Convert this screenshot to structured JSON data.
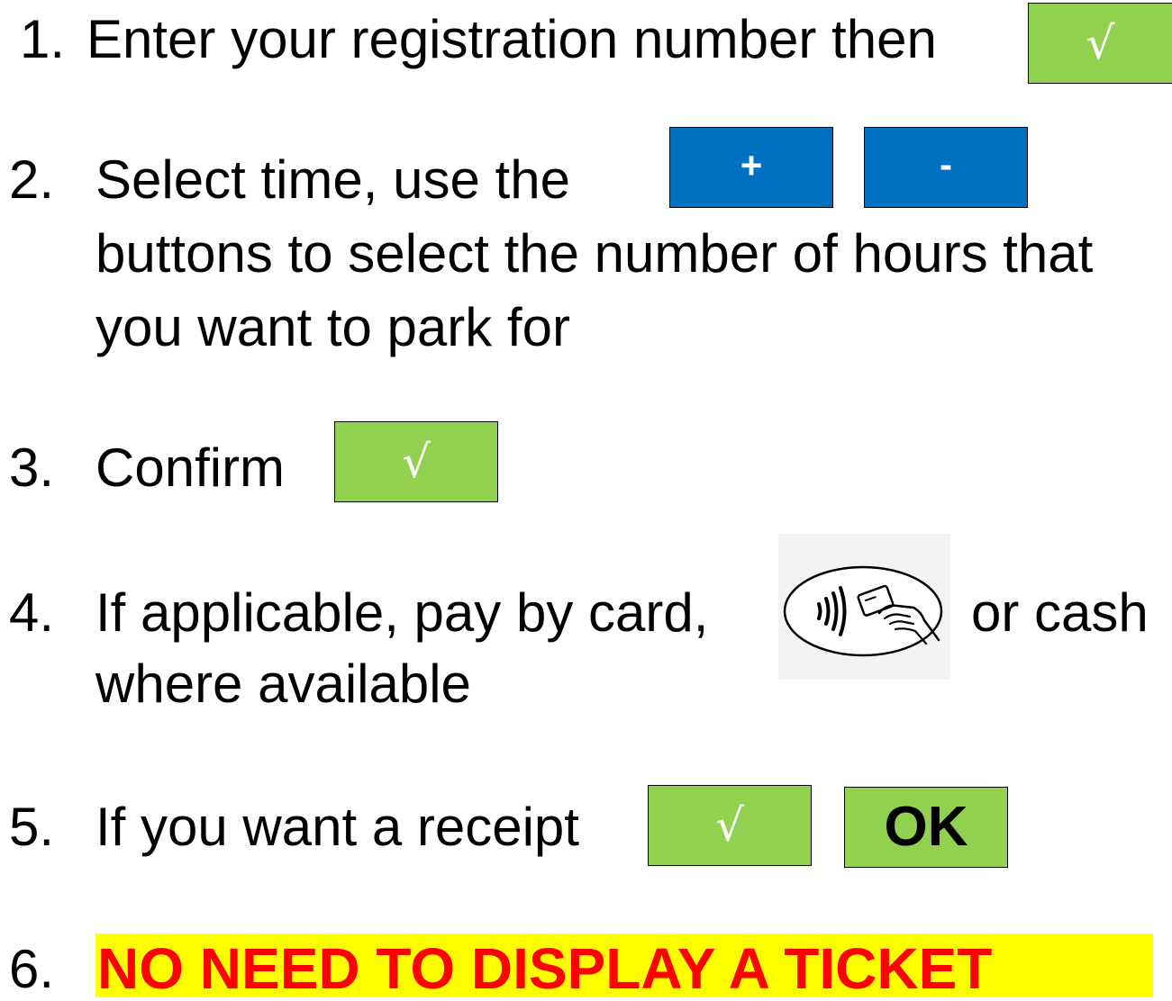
{
  "step1": {
    "number": "1.",
    "text": "Enter your registration number then",
    "button_label": "√"
  },
  "step2": {
    "number": "2.",
    "line1": "Select time, use the",
    "line2": "buttons to select the number of hours that",
    "line3": "you want to park for",
    "plus_label": "+",
    "minus_label": "-"
  },
  "step3": {
    "number": "3.",
    "text": "Confirm",
    "button_label": "√"
  },
  "step4": {
    "number": "4.",
    "line1_before": "If applicable, pay by card,",
    "line1_after": "or cash",
    "line2": "where available",
    "icon": "contactless-card-icon"
  },
  "step5": {
    "number": "5.",
    "text": "If you want a receipt",
    "tick_label": "√",
    "ok_label": "OK"
  },
  "step6": {
    "number": "6.",
    "text": "NO NEED TO DISPLAY A TICKET"
  },
  "colors": {
    "green_button": "#92d050",
    "blue_button": "#0070c0",
    "warning_text": "#ff0000",
    "highlight": "#ffff00"
  }
}
